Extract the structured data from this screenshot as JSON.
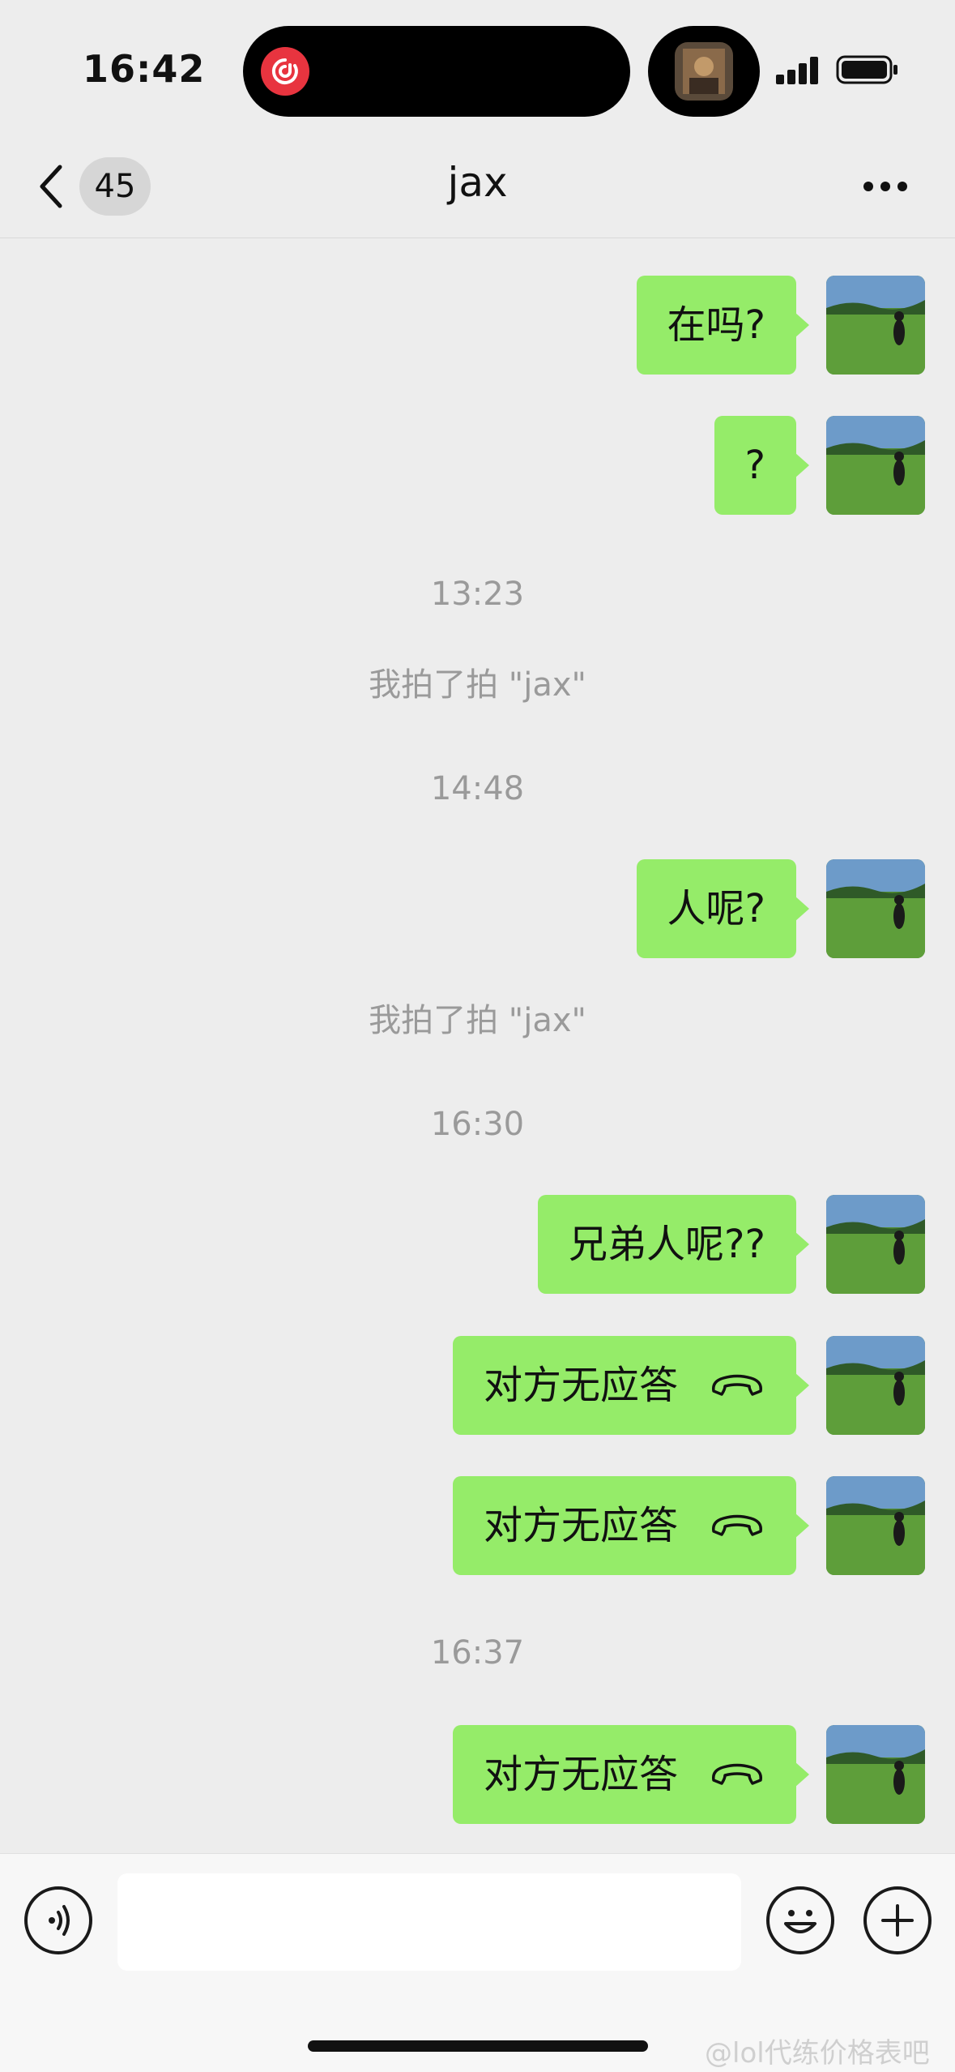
{
  "status_bar": {
    "time": "16:42"
  },
  "nav": {
    "unread_count": "45",
    "title": "jax"
  },
  "colors": {
    "bubble_self": "#95ec69",
    "background": "#ededed",
    "system_text": "#9a9a9a"
  },
  "messages": [
    {
      "type": "text",
      "text": "在吗?"
    },
    {
      "type": "text",
      "text": "?"
    },
    {
      "type": "timestamp",
      "text": "13:23"
    },
    {
      "type": "system",
      "text": "我拍了拍 \"jax\""
    },
    {
      "type": "timestamp",
      "text": "14:48"
    },
    {
      "type": "text",
      "text": "人呢?"
    },
    {
      "type": "system",
      "text": "我拍了拍 \"jax\""
    },
    {
      "type": "timestamp",
      "text": "16:30"
    },
    {
      "type": "text",
      "text": "兄弟人呢??"
    },
    {
      "type": "call",
      "text": "对方无应答",
      "icon": "phone-hangup-icon"
    },
    {
      "type": "call",
      "text": "对方无应答",
      "icon": "phone-hangup-icon"
    },
    {
      "type": "timestamp",
      "text": "16:37"
    },
    {
      "type": "call",
      "text": "对方无应答",
      "icon": "phone-hangup-icon"
    }
  ],
  "input_bar": {
    "placeholder": "",
    "value": ""
  },
  "watermark": "@lol代练价格表吧"
}
